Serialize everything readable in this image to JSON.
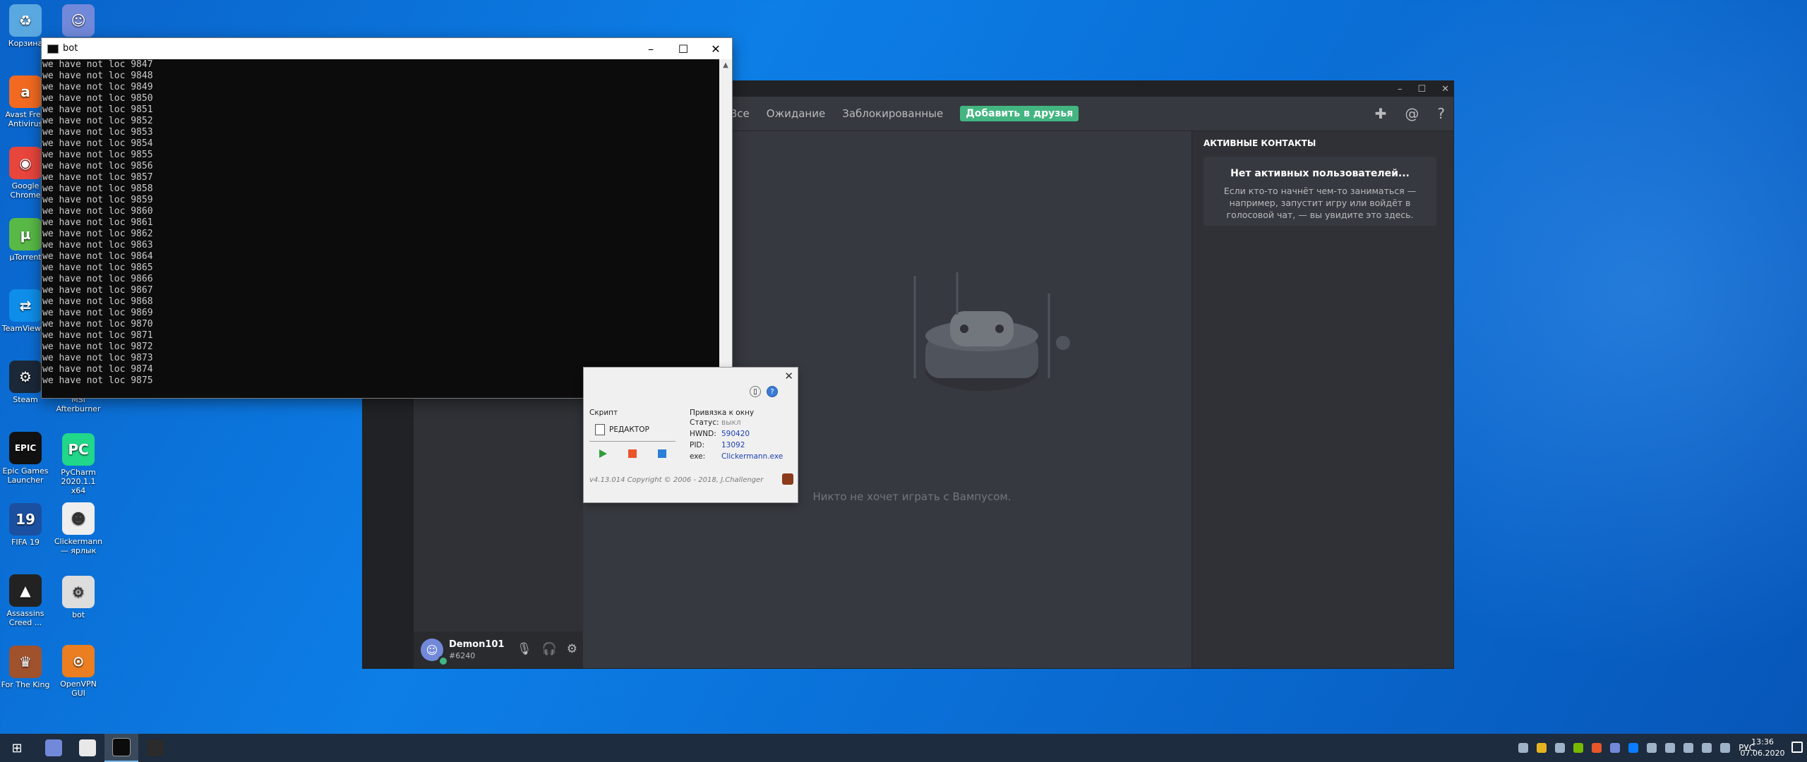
{
  "desktop": {
    "icons_left": [
      {
        "label": "Корзина",
        "color": "#5aa8e0",
        "glyph": "♻"
      },
      {
        "label": "Avast Free Antivirus",
        "color": "#f26a21",
        "glyph": "a"
      },
      {
        "label": "Google Chrome",
        "color": "#e8453c",
        "glyph": "◉"
      },
      {
        "label": "µTorrent",
        "color": "#59b947",
        "glyph": "µ"
      },
      {
        "label": "TeamViewer",
        "color": "#0e8ee9",
        "glyph": "⇄"
      },
      {
        "label": "Steam",
        "color": "#1b2838",
        "glyph": "⚙"
      },
      {
        "label": "Epic Games Launcher",
        "color": "#111111",
        "glyph": "EPIC"
      },
      {
        "label": "FIFA 19",
        "color": "#1b4fa0",
        "glyph": "19"
      },
      {
        "label": "Assassins Creed ...",
        "color": "#222222",
        "glyph": "▲"
      },
      {
        "label": "For The King",
        "color": "#a0522d",
        "glyph": "♛"
      }
    ],
    "icons_right": [
      {
        "label": "Discord",
        "color": "#7289da",
        "glyph": "☺"
      },
      {
        "label": "MSI Afterburner",
        "color": "#333333",
        "glyph": "✈"
      },
      {
        "label": "PyCharm 2020.1.1 x64",
        "color": "#21d789",
        "glyph": "PC"
      },
      {
        "label": "Clickermann — ярлык",
        "color": "#eeeeee",
        "glyph": "☻"
      },
      {
        "label": "bot",
        "color": "#dddddd",
        "glyph": "⚙"
      },
      {
        "label": "OpenVPN GUI",
        "color": "#ea7e20",
        "glyph": "⊙"
      }
    ]
  },
  "console": {
    "title": "bot",
    "lines": [
      "we have not loc 9847",
      "we have not loc 9848",
      "we have not loc 9849",
      "we have not loc 9850",
      "we have not loc 9851",
      "we have not loc 9852",
      "we have not loc 9853",
      "we have not loc 9854",
      "we have not loc 9855",
      "we have not loc 9856",
      "we have not loc 9857",
      "we have not loc 9858",
      "we have not loc 9859",
      "we have not loc 9860",
      "we have not loc 9861",
      "we have not loc 9862",
      "we have not loc 9863",
      "we have not loc 9864",
      "we have not loc 9865",
      "we have not loc 9866",
      "we have not loc 9867",
      "we have not loc 9868",
      "we have not loc 9869",
      "we have not loc 9870",
      "we have not loc 9871",
      "we have not loc 9872",
      "we have not loc 9873",
      "we have not loc 9874",
      "we have not loc 9875"
    ]
  },
  "discord": {
    "tabs": [
      "Все",
      "Ожидание",
      "Заблокированные"
    ],
    "add_friend": "Добавить в друзья",
    "empty_text": "Никто не хочет играть с Вампусом.",
    "active_title": "АКТИВНЫЕ КОНТАКТЫ",
    "active_head": "Нет активных пользователей...",
    "active_text": "Если кто-то начнёт чем-то заниматься — например, запустит игру или войдёт в голосовой чат, — вы увидите это здесь.",
    "user": {
      "name": "Demon101",
      "tag": "#6240"
    }
  },
  "clickermann": {
    "script_label": "Скрипт",
    "editor_label": "РЕДАКТОР",
    "bind_label": "Привязка к окну",
    "rows": [
      {
        "k": "Статус:",
        "v": "выкл"
      },
      {
        "k": "HWND:",
        "v": "590420"
      },
      {
        "k": "PID:",
        "v": "13092"
      },
      {
        "k": "exe:",
        "v": "Clickermann.exe"
      }
    ],
    "footer": "v4.13.014  Copyright © 2006 - 2018, J.Challenger"
  },
  "taskbar": {
    "lang": "РУС",
    "time": "13:36",
    "date": "07.06.2020"
  },
  "colors": {
    "discord_bg": "#36393f",
    "discord_green": "#43b581",
    "console_bg": "#0c0c0c",
    "taskbar_bg": "#1d2c3e"
  }
}
